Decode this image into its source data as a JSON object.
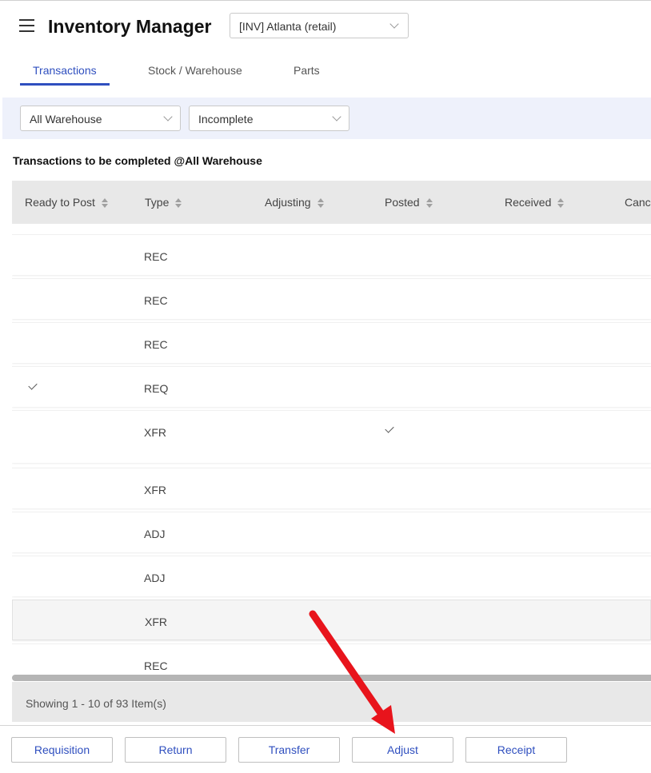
{
  "app": {
    "title": "Inventory Manager",
    "store_select": "[INV] Atlanta (retail)"
  },
  "tabs": [
    {
      "label": "Transactions",
      "active": true
    },
    {
      "label": "Stock / Warehouse",
      "active": false
    },
    {
      "label": "Parts",
      "active": false
    }
  ],
  "filters": {
    "warehouse": "All Warehouse",
    "status": "Incomplete"
  },
  "section_title": "Transactions to be completed @All Warehouse",
  "table": {
    "columns": [
      "Ready to Post",
      "Type",
      "Adjusting",
      "Posted",
      "Received",
      "Canc"
    ],
    "rows": [
      {
        "type": "REC",
        "ready_to_post": false,
        "posted": false
      },
      {
        "type": "REC",
        "ready_to_post": false,
        "posted": false
      },
      {
        "type": "REC",
        "ready_to_post": false,
        "posted": false
      },
      {
        "type": "REQ",
        "ready_to_post": true,
        "posted": false
      },
      {
        "type": "XFR",
        "ready_to_post": false,
        "posted": true
      },
      {
        "type": "XFR",
        "ready_to_post": false,
        "posted": false
      },
      {
        "type": "ADJ",
        "ready_to_post": false,
        "posted": false
      },
      {
        "type": "ADJ",
        "ready_to_post": false,
        "posted": false
      },
      {
        "type": "XFR",
        "ready_to_post": false,
        "posted": false,
        "highlighted": true
      },
      {
        "type": "REC",
        "ready_to_post": false,
        "posted": false
      }
    ]
  },
  "pagination": {
    "text": "Showing 1 - 10 of 93 Item(s)"
  },
  "actions": [
    "Requisition",
    "Return",
    "Transfer",
    "Adjust",
    "Receipt"
  ],
  "colors": {
    "accent": "#2f4fbf",
    "annotation_arrow": "#e8141c",
    "filter_bar": "#eef1fb"
  }
}
